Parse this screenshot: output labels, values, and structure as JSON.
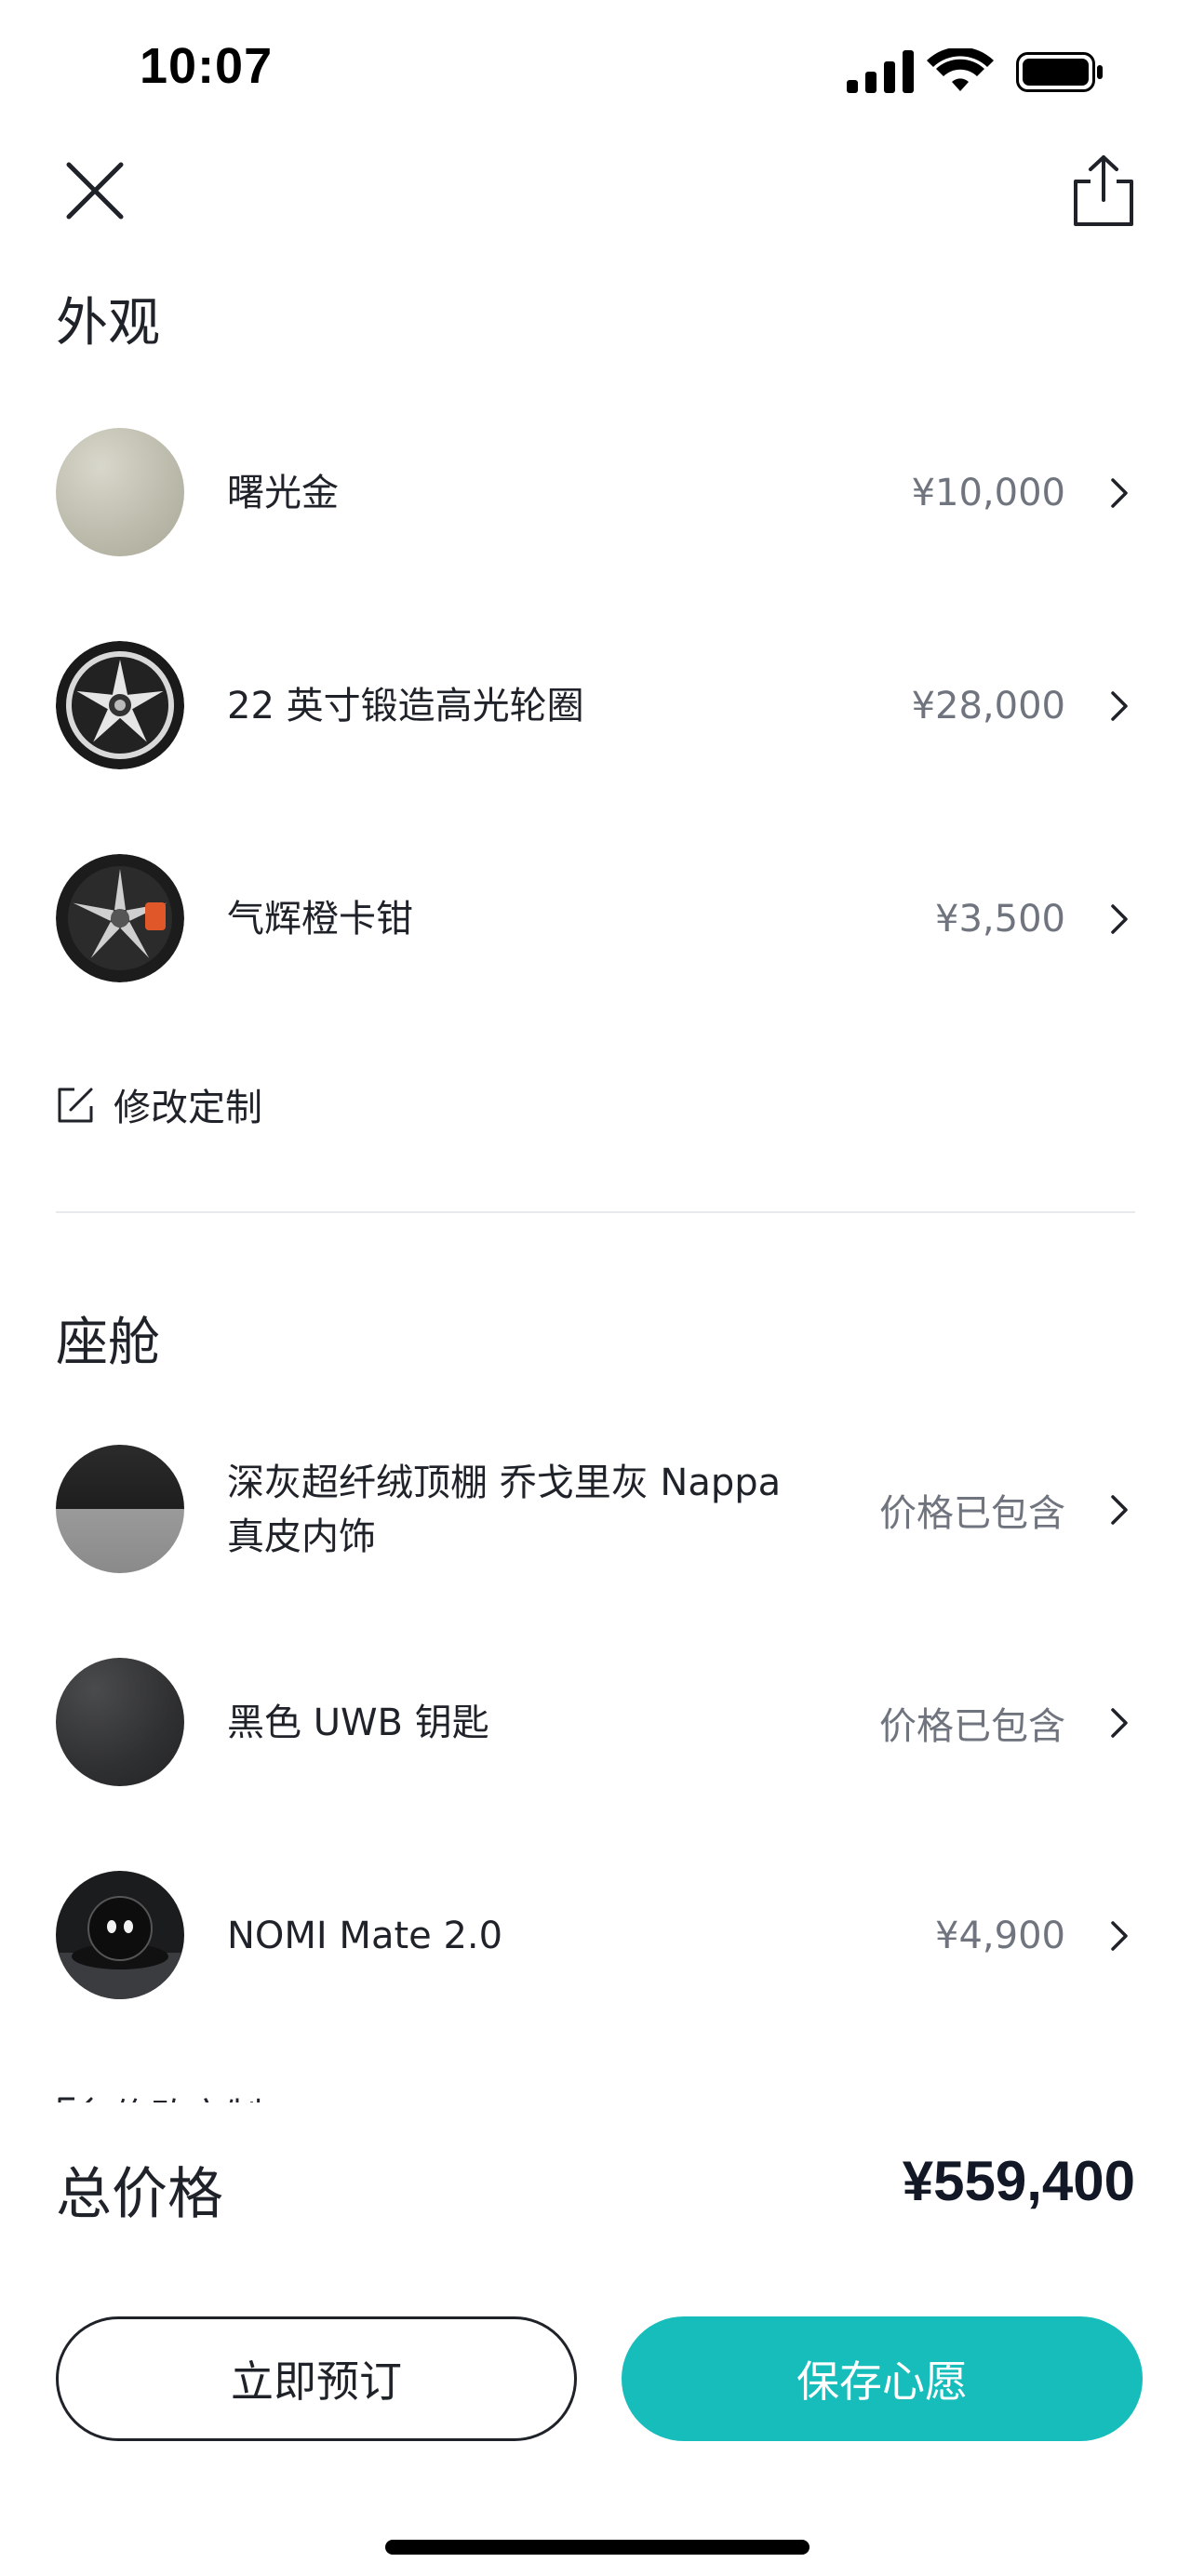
{
  "status_bar": {
    "time": "10:07"
  },
  "exterior": {
    "title": "外观",
    "items": [
      {
        "name": "曙光金",
        "price": "¥10,000",
        "thumb": "color-swatch-gold"
      },
      {
        "name": "22 英寸锻造高光轮圈",
        "price": "¥28,000",
        "thumb": "wheel"
      },
      {
        "name": "气辉橙卡钳",
        "price": "¥3,500",
        "thumb": "wheel-caliper"
      }
    ],
    "modify_label": "修改定制"
  },
  "cabin": {
    "title": "座舱",
    "items": [
      {
        "name": "深灰超纤绒顶棚 乔戈里灰 Nappa 真皮内饰",
        "price": "价格已包含",
        "thumb": "interior-swatch"
      },
      {
        "name": "黑色 UWB 钥匙",
        "price": "价格已包含",
        "thumb": "key-swatch"
      },
      {
        "name": "NOMI Mate 2.0",
        "price": "¥4,900",
        "thumb": "nomi-device"
      }
    ],
    "modify_label": "修改定制"
  },
  "footer": {
    "total_label": "总价格",
    "total_value": "¥559,400",
    "order_button": "立即预订",
    "save_button": "保存心愿"
  },
  "colors": {
    "accent": "#16bdbb",
    "text": "#1f2229",
    "muted": "#6f747e"
  }
}
